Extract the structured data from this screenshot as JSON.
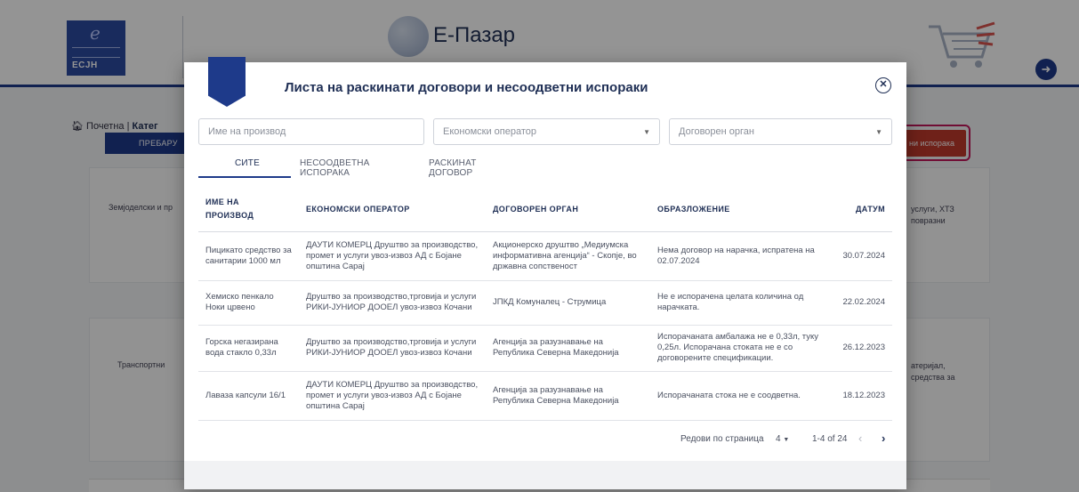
{
  "background": {
    "logo_text": "ECJH",
    "brand": "Е-Пазар",
    "breadcrumb_home": "Почетна",
    "breadcrumb_current": "Катег",
    "nav_button": "ПРЕБАРУ",
    "action_button": "ни испорака",
    "card_left_1": "Земјоделски и пр",
    "card_left_2": "Транспортни",
    "card_right_1_line1": "услуги, ХТЗ",
    "card_right_1_line2": "повразни",
    "card_right_2_line1": "атеријал,",
    "card_right_2_line2": "средства за"
  },
  "modal": {
    "title": "Листа на раскинати договори и несоодветни испораки",
    "filters": {
      "product_placeholder": "Име на производ",
      "operator_placeholder": "Економски оператор",
      "authority_placeholder": "Договорен орган"
    },
    "tabs": [
      "СИТЕ",
      "НЕСООДВЕТНА ИСПОРАКА",
      "РАСКИНАТ ДОГОВОР"
    ],
    "columns": {
      "product_line1": "ИМЕ НА",
      "product_line2": "ПРОИЗВОД",
      "operator": "ЕКОНОМСКИ ОПЕРАТОР",
      "authority": "ДОГОВОРЕН ОРГАН",
      "reason": "ОБРАЗЛОЖЕНИЕ",
      "date": "ДАТУМ"
    },
    "rows": [
      {
        "product": "Пицикато средство за санитарии 1000 мл",
        "operator": "ДАУТИ КОМЕРЦ Друштво за производство, промет и услуги увоз-извоз АД с Бојане општина Сарај",
        "authority": "Акционерско друштво „Медиумска информативна агенција“ - Скопје, во државна сопственост",
        "reason": "Нема договор на нарачка, испратена на 02.07.2024",
        "date": "30.07.2024"
      },
      {
        "product": "Хемиско пенкало Ноки црвено",
        "operator": "Друштво за производство,трговија и услуги РИКИ-ЈУНИОР ДООЕЛ увоз-извоз Кочани",
        "authority": "ЈПКД Комуналец - Струмица",
        "reason": "Не е испорачена целата количина од нарачката.",
        "date": "22.02.2024"
      },
      {
        "product": "Горска негазирана вода стакло 0,33л",
        "operator": "Друштво за производство,трговија и услуги РИКИ-ЈУНИОР ДООЕЛ увоз-извоз Кочани",
        "authority": "Агенција за разузнавање на Република Северна Македонија",
        "reason": "Испорачаната амбалажа не е 0,33л, туку 0,25л. Испорачана стоката не е со договорените спецификации.",
        "date": "26.12.2023"
      },
      {
        "product": "Лаваза капсули 16/1",
        "operator": "ДАУТИ КОМЕРЦ Друштво за производство, промет и услуги увоз-извоз АД с Бојане општина Сарај",
        "authority": "Агенција за разузнавање на Република Северна Македонија",
        "reason": "Испорачаната стока не е соодветна.",
        "date": "18.12.2023"
      }
    ],
    "pagination": {
      "rows_per_page_label": "Редови по страница",
      "rows_per_page_value": "4",
      "range": "1-4 of 24",
      "prev": "‹",
      "next": "›"
    }
  },
  "colors": {
    "brand_navy": "#1e3a8a",
    "accent_red": "#c0392b"
  }
}
